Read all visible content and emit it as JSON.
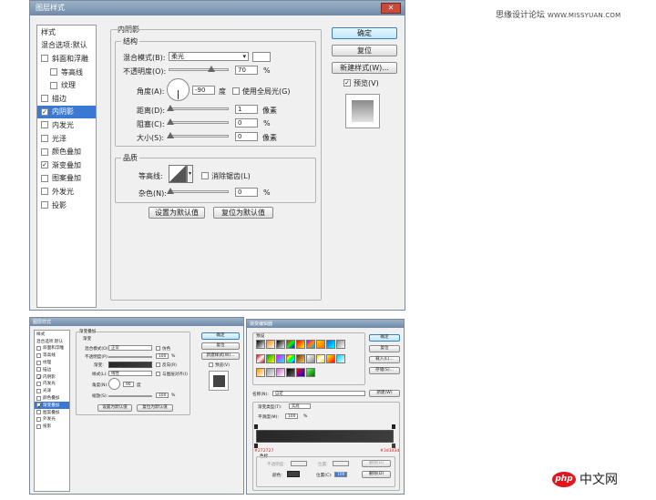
{
  "watermark": {
    "text": "思缘设计论坛",
    "url": "WWW.MISSYUAN.COM"
  },
  "dialog": {
    "title": "图层样式",
    "close_glyph": "✕",
    "sidebar": [
      {
        "label": "样式",
        "cb": false,
        "show_cb": false,
        "sub": false,
        "sel": false
      },
      {
        "label": "混合选项:默认",
        "cb": false,
        "show_cb": false,
        "sub": false,
        "sel": false
      },
      {
        "label": "斜面和浮雕",
        "cb": false,
        "show_cb": true,
        "sub": false,
        "sel": false
      },
      {
        "label": "等高线",
        "cb": false,
        "show_cb": true,
        "sub": true,
        "sel": false
      },
      {
        "label": "纹理",
        "cb": false,
        "show_cb": true,
        "sub": true,
        "sel": false
      },
      {
        "label": "描边",
        "cb": false,
        "show_cb": true,
        "sub": false,
        "sel": false
      },
      {
        "label": "内阴影",
        "cb": true,
        "show_cb": true,
        "sub": false,
        "sel": true
      },
      {
        "label": "内发光",
        "cb": false,
        "show_cb": true,
        "sub": false,
        "sel": false
      },
      {
        "label": "光泽",
        "cb": false,
        "show_cb": true,
        "sub": false,
        "sel": false
      },
      {
        "label": "颜色叠加",
        "cb": false,
        "show_cb": true,
        "sub": false,
        "sel": false
      },
      {
        "label": "渐变叠加",
        "cb": true,
        "show_cb": true,
        "sub": false,
        "sel": false
      },
      {
        "label": "图案叠加",
        "cb": false,
        "show_cb": true,
        "sub": false,
        "sel": false
      },
      {
        "label": "外发光",
        "cb": false,
        "show_cb": true,
        "sub": false,
        "sel": false
      },
      {
        "label": "投影",
        "cb": false,
        "show_cb": true,
        "sub": false,
        "sel": false
      }
    ],
    "section_title": "内阴影",
    "structure": {
      "title": "结构",
      "blend_label": "混合模式(B):",
      "blend_value": "柔光",
      "opacity_label": "不透明度(O):",
      "opacity_value": "70",
      "opacity_unit": "%",
      "opacity_level": 0.7,
      "angle_label": "角度(A):",
      "angle_value": "-90",
      "angle_unit": "度",
      "global_light_label": "使用全局光(G)",
      "distance_label": "距离(D):",
      "distance_value": "1",
      "distance_unit": "像素",
      "choke_label": "阻塞(C):",
      "choke_value": "0",
      "choke_unit": "%",
      "size_label": "大小(S):",
      "size_value": "0",
      "size_unit": "像素"
    },
    "quality": {
      "title": "品质",
      "contour_label": "等高线:",
      "antialias_label": "消除锯齿(L)",
      "noise_label": "杂色(N):",
      "noise_value": "0",
      "noise_unit": "%"
    },
    "buttons": {
      "set_default": "设置为默认值",
      "reset_default": "复位为默认值",
      "ok": "确定",
      "cancel": "复位",
      "new_style": "新建样式(W)...",
      "preview": "预览(V)"
    }
  },
  "dialog2": {
    "title": "图层样式",
    "section_title": "渐变叠加",
    "group": "渐变",
    "blend_label": "混合模式(O):",
    "blend_value": "正常",
    "dither_label": "仿色",
    "opacity_label": "不透明度(P):",
    "opacity_value": "100",
    "opacity_unit": "%",
    "gradient_label": "渐变:",
    "reverse_label": "反向(R)",
    "style_label": "样式(L):",
    "style_value": "线性",
    "align_label": "与图层对齐(I)",
    "angle_label": "角度(N):",
    "angle_value": "90",
    "angle_unit": "度",
    "scale_label": "缩放(S):",
    "scale_value": "100",
    "scale_unit": "%",
    "set_default": "设置为默认值",
    "reset_default": "复位为默认值",
    "ok": "确定",
    "cancel": "复位",
    "new_style": "新建样式(W)...",
    "preview": "预览(V)"
  },
  "gradient_editor": {
    "title": "渐变编辑器",
    "presets_label": "预设",
    "ok": "确定",
    "cancel": "复位",
    "load": "载入(L)...",
    "save": "存储(S)...",
    "name_label": "名称(N):",
    "name_value": "自定",
    "new_btn": "新建(W)",
    "type_label": "渐变类型(T):",
    "type_value": "实底",
    "smooth_label": "平滑度(M):",
    "smooth_value": "100",
    "smooth_unit": "%",
    "hex_left": "#272727",
    "hex_right": "#3d3d3d",
    "stops_label": "色标",
    "opacity_label": "不透明度:",
    "location_label": "位置:",
    "delete_label": "删除(D)",
    "color_label": "颜色:",
    "location2_label": "位置(C):",
    "location2_value": "100",
    "delete2_label": "删除(D)"
  },
  "logo": {
    "php": "php",
    "cn": "中文网"
  }
}
